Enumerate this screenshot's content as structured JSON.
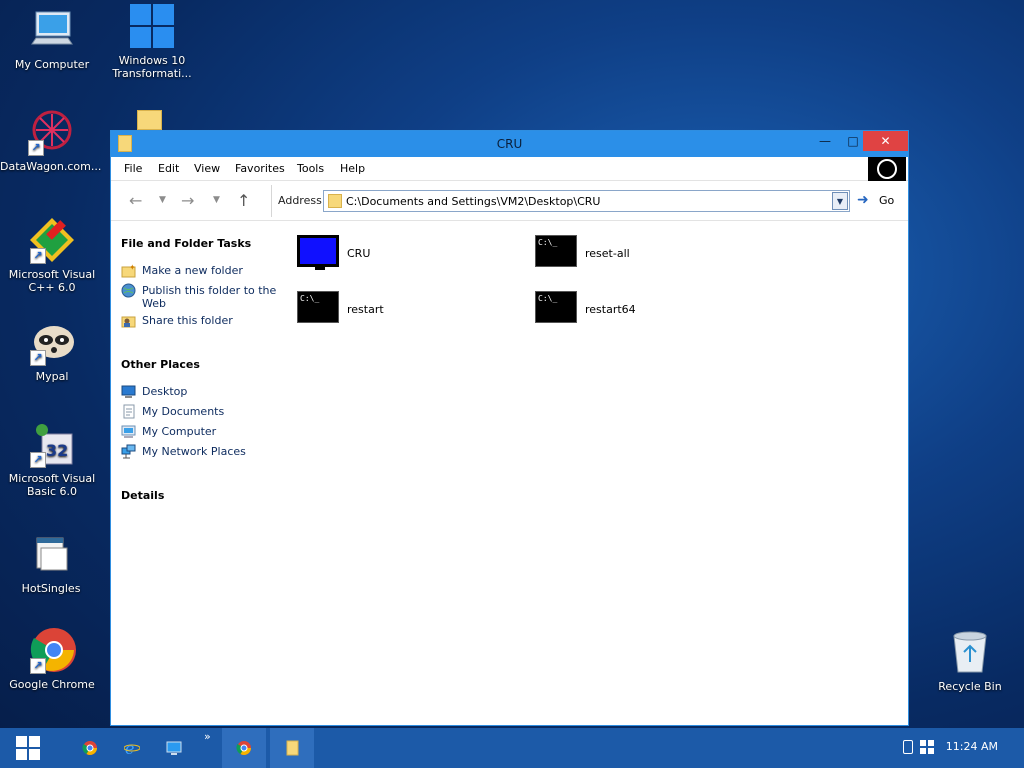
{
  "desktop": {
    "icons": [
      {
        "label": "My Computer",
        "icon": "computer-icon"
      },
      {
        "label": "Windows 10 Transformati...",
        "icon": "windows-logo-icon"
      },
      {
        "label": "DataWagon.com...",
        "icon": "datawagon-icon"
      },
      {
        "label": "Microsoft Visual C++ 6.0",
        "icon": "visual-cpp-icon"
      },
      {
        "label": "Mypal",
        "icon": "raccoon-icon"
      },
      {
        "label": "Microsoft Visual Basic 6.0",
        "icon": "visual-basic-icon"
      },
      {
        "label": "HotSingles",
        "icon": "hotsingles-icon"
      },
      {
        "label": "Google Chrome",
        "icon": "chrome-icon"
      },
      {
        "label": "Recycle Bin",
        "icon": "recycle-bin-icon"
      }
    ]
  },
  "window": {
    "title": "CRU",
    "menu": [
      "File",
      "Edit",
      "View",
      "Favorites",
      "Tools",
      "Help"
    ],
    "address_label": "Address",
    "address_value": "C:\\Documents and Settings\\VM2\\Desktop\\CRU",
    "go_label": "Go",
    "taskpane": {
      "file_tasks_title": "File and Folder Tasks",
      "file_tasks": [
        "Make a new folder",
        "Publish this folder to the Web",
        "Share this folder"
      ],
      "other_places_title": "Other Places",
      "other_places": [
        "Desktop",
        "My Documents",
        "My Computer",
        "My Network Places"
      ],
      "details_title": "Details"
    },
    "files": [
      {
        "name": "CRU",
        "icon": "monitor-icon"
      },
      {
        "name": "reset-all",
        "icon": "cmd-icon"
      },
      {
        "name": "restart",
        "icon": "cmd-icon"
      },
      {
        "name": "restart64",
        "icon": "cmd-icon"
      }
    ],
    "cmd_glyph": "C:\\_"
  },
  "taskbar": {
    "clock": "11:24 AM",
    "overflow": "»"
  },
  "colors": {
    "titlebar": "#2b8fe8",
    "close_button": "#e04343",
    "taskbar": "#1c5aa8"
  }
}
